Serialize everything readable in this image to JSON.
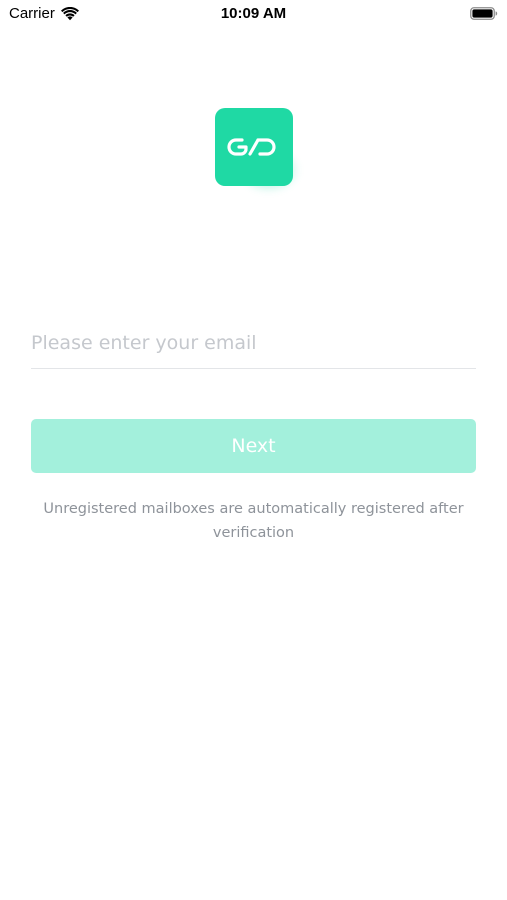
{
  "status_bar": {
    "carrier": "Carrier",
    "time": "10:09 AM",
    "icons": [
      "wifi-icon",
      "battery-icon"
    ]
  },
  "logo": {
    "icon": "app-logo-icon",
    "color": "#1fd9a4"
  },
  "login": {
    "email_placeholder": "Please enter your email",
    "email_value": "",
    "next_label": "Next",
    "next_button_color": "#a3f0dc",
    "hint": "Unregistered mailboxes are automatically registered after verification"
  }
}
